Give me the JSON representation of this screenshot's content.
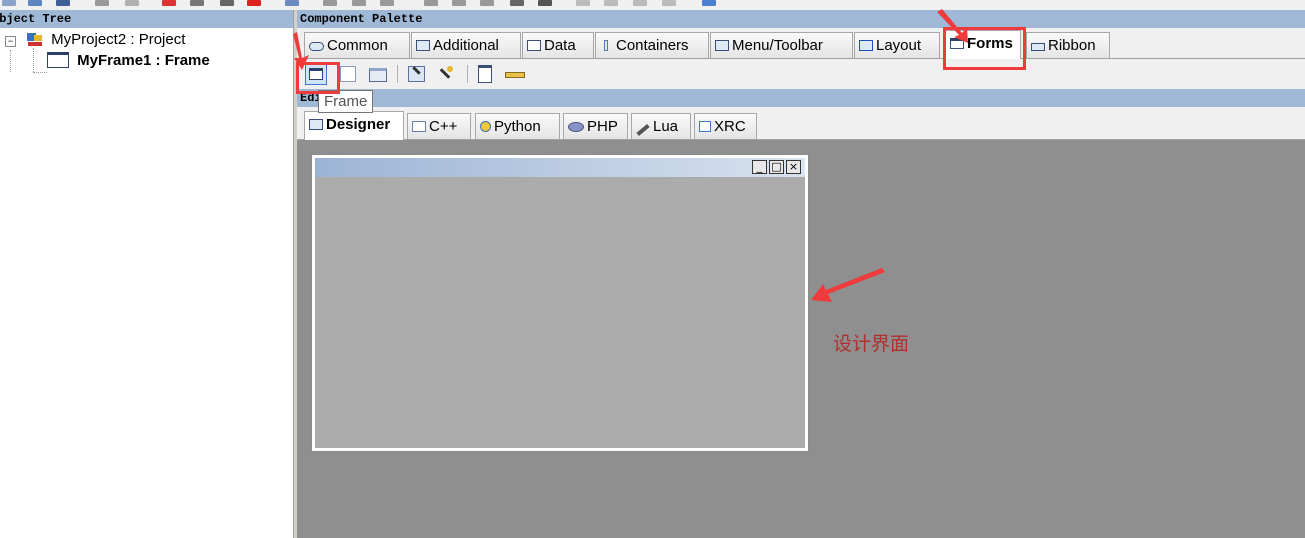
{
  "object_tree": {
    "caption": "Object Tree",
    "items": [
      {
        "label": "MyProject2 : Project"
      },
      {
        "label": "MyFrame1 : Frame"
      }
    ]
  },
  "palette": {
    "caption": "Component Palette",
    "tabs": [
      {
        "label": "Common",
        "icon": "common-icon"
      },
      {
        "label": "Additional",
        "icon": "additional-icon"
      },
      {
        "label": "Data",
        "icon": "data-icon"
      },
      {
        "label": "Containers",
        "icon": "containers-icon"
      },
      {
        "label": "Menu/Toolbar",
        "icon": "menu-toolbar-icon"
      },
      {
        "label": "Layout",
        "icon": "layout-icon"
      },
      {
        "label": "Forms",
        "icon": "forms-icon",
        "active": true
      },
      {
        "label": "Ribbon",
        "icon": "ribbon-icon"
      }
    ],
    "tooltip": "Frame"
  },
  "editor": {
    "caption": "Editor",
    "tabs": [
      {
        "label": "Designer",
        "active": true
      },
      {
        "label": "C++"
      },
      {
        "label": "Python"
      },
      {
        "label": "PHP"
      },
      {
        "label": "Lua"
      },
      {
        "label": "XRC"
      }
    ]
  },
  "frame_window": {
    "minimize": "_",
    "maximize": "□",
    "close": "×"
  },
  "annotation": {
    "label": "设计界面",
    "color": "#ef3b3b"
  }
}
